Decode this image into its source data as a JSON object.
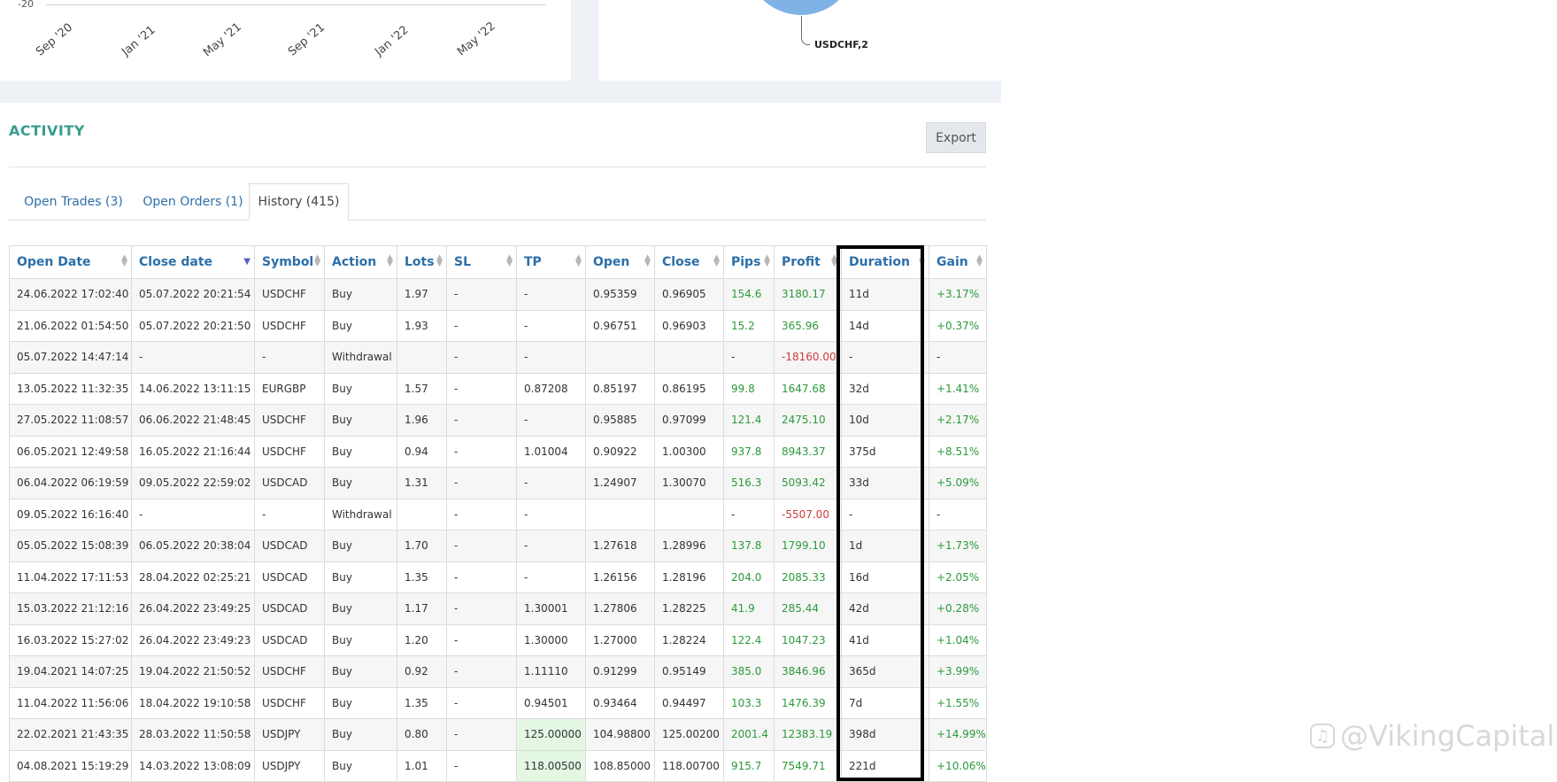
{
  "chart_data": {
    "type": "line",
    "y_ticks": [
      "-20"
    ],
    "x_ticks": [
      "Sep '20",
      "Jan '21",
      "May '21",
      "Sep '21",
      "Jan '22",
      "May '22"
    ]
  },
  "pie": {
    "visible_label": "USDCHF,2"
  },
  "activity": {
    "title": "ACTIVITY",
    "export_label": "Export"
  },
  "tabs": [
    {
      "label": "Open Trades (3)",
      "active": false
    },
    {
      "label": "Open Orders (1)",
      "active": false
    },
    {
      "label": "History (415)",
      "active": true
    }
  ],
  "table": {
    "headers": [
      "Open Date",
      "Close date",
      "Symbol",
      "Action",
      "Lots",
      "SL",
      "TP",
      "Open",
      "Close",
      "Pips",
      "Profit",
      "Duration",
      "Gain"
    ],
    "rows": [
      [
        "24.06.2022 17:02:40",
        "05.07.2022 20:21:54",
        "USDCHF",
        "Buy",
        "1.97",
        "-",
        "-",
        "0.95359",
        "0.96905",
        "154.6",
        "3180.17",
        "11d",
        "+3.17%"
      ],
      [
        "21.06.2022 01:54:50",
        "05.07.2022 20:21:50",
        "USDCHF",
        "Buy",
        "1.93",
        "-",
        "-",
        "0.96751",
        "0.96903",
        "15.2",
        "365.96",
        "14d",
        "+0.37%"
      ],
      [
        "05.07.2022 14:47:14",
        "-",
        "-",
        "Withdrawal",
        "",
        "-",
        "-",
        "",
        "",
        "-",
        "-18160.00",
        "-",
        "-"
      ],
      [
        "13.05.2022 11:32:35",
        "14.06.2022 13:11:15",
        "EURGBP",
        "Buy",
        "1.57",
        "-",
        "0.87208",
        "0.85197",
        "0.86195",
        "99.8",
        "1647.68",
        "32d",
        "+1.41%"
      ],
      [
        "27.05.2022 11:08:57",
        "06.06.2022 21:48:45",
        "USDCHF",
        "Buy",
        "1.96",
        "-",
        "-",
        "0.95885",
        "0.97099",
        "121.4",
        "2475.10",
        "10d",
        "+2.17%"
      ],
      [
        "06.05.2021 12:49:58",
        "16.05.2022 21:16:44",
        "USDCHF",
        "Buy",
        "0.94",
        "-",
        "1.01004",
        "0.90922",
        "1.00300",
        "937.8",
        "8943.37",
        "375d",
        "+8.51%"
      ],
      [
        "06.04.2022 06:19:59",
        "09.05.2022 22:59:02",
        "USDCAD",
        "Buy",
        "1.31",
        "-",
        "-",
        "1.24907",
        "1.30070",
        "516.3",
        "5093.42",
        "33d",
        "+5.09%"
      ],
      [
        "09.05.2022 16:16:40",
        "-",
        "-",
        "Withdrawal",
        "",
        "-",
        "-",
        "",
        "",
        "-",
        "-5507.00",
        "-",
        "-"
      ],
      [
        "05.05.2022 15:08:39",
        "06.05.2022 20:38:04",
        "USDCAD",
        "Buy",
        "1.70",
        "-",
        "-",
        "1.27618",
        "1.28996",
        "137.8",
        "1799.10",
        "1d",
        "+1.73%"
      ],
      [
        "11.04.2022 17:11:53",
        "28.04.2022 02:25:21",
        "USDCAD",
        "Buy",
        "1.35",
        "-",
        "-",
        "1.26156",
        "1.28196",
        "204.0",
        "2085.33",
        "16d",
        "+2.05%"
      ],
      [
        "15.03.2022 21:12:16",
        "26.04.2022 23:49:25",
        "USDCAD",
        "Buy",
        "1.17",
        "-",
        "1.30001",
        "1.27806",
        "1.28225",
        "41.9",
        "285.44",
        "42d",
        "+0.28%"
      ],
      [
        "16.03.2022 15:27:02",
        "26.04.2022 23:49:23",
        "USDCAD",
        "Buy",
        "1.20",
        "-",
        "1.30000",
        "1.27000",
        "1.28224",
        "122.4",
        "1047.23",
        "41d",
        "+1.04%"
      ],
      [
        "19.04.2021 14:07:25",
        "19.04.2022 21:50:52",
        "USDCHF",
        "Buy",
        "0.92",
        "-",
        "1.11110",
        "0.91299",
        "0.95149",
        "385.0",
        "3846.96",
        "365d",
        "+3.99%"
      ],
      [
        "11.04.2022 11:56:06",
        "18.04.2022 19:10:58",
        "USDCHF",
        "Buy",
        "1.35",
        "-",
        "0.94501",
        "0.93464",
        "0.94497",
        "103.3",
        "1476.39",
        "7d",
        "+1.55%"
      ],
      [
        "22.02.2021 21:43:35",
        "28.03.2022 11:50:58",
        "USDJPY",
        "Buy",
        "0.80",
        "-",
        "125.00000",
        "104.98800",
        "125.00200",
        "2001.4",
        "12383.19",
        "398d",
        "+14.99%"
      ],
      [
        "04.08.2021 15:19:29",
        "14.03.2022 13:08:09",
        "USDJPY",
        "Buy",
        "1.01",
        "-",
        "118.00500",
        "108.85000",
        "118.00700",
        "915.7",
        "7549.71",
        "221d",
        "+10.06%"
      ]
    ]
  },
  "watermark": {
    "text": "@VikingCapital"
  },
  "colors": {
    "accent": "#3a9d8f",
    "link": "#2d6fa8",
    "positive": "#2b9a3b",
    "negative": "#d03a3a"
  }
}
